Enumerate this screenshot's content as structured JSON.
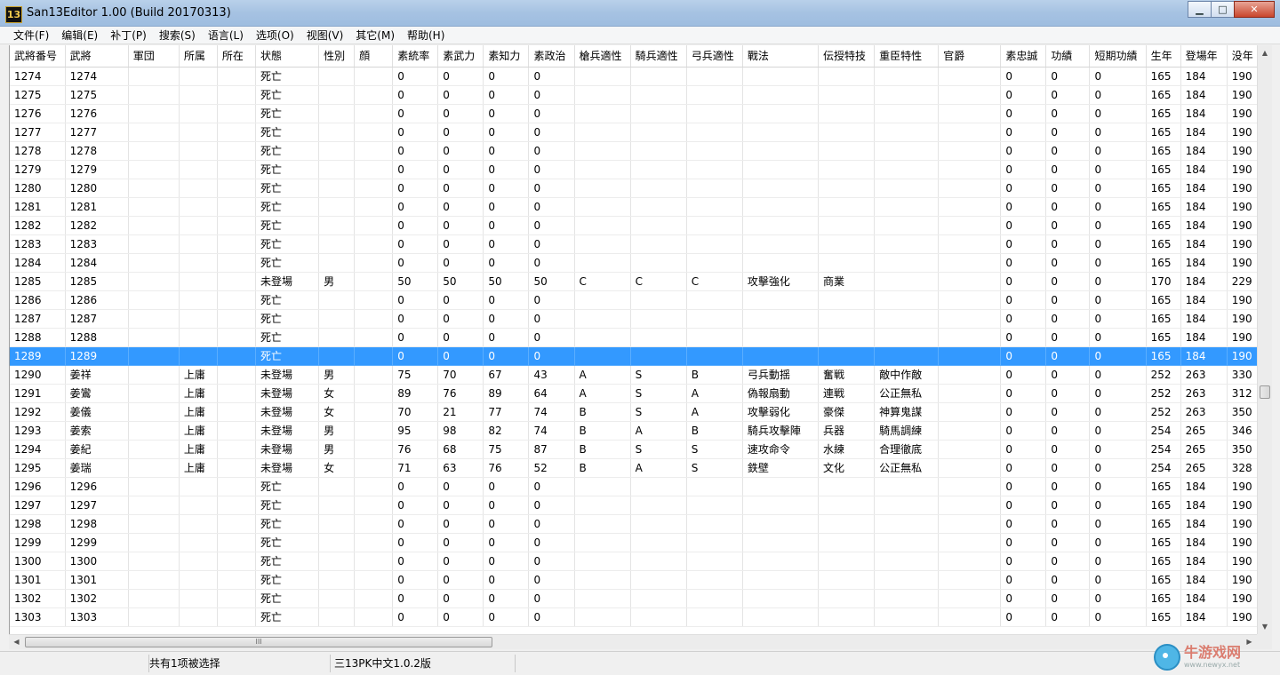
{
  "window": {
    "icon_text": "13",
    "title": "San13Editor 1.00 (Build 20170313)",
    "min_glyph": "▁",
    "max_glyph": "□",
    "close_glyph": "✕"
  },
  "menu": [
    {
      "label": "文件(F)"
    },
    {
      "label": "编辑(E)"
    },
    {
      "label": "补丁(P)"
    },
    {
      "label": "搜索(S)"
    },
    {
      "label": "语言(L)"
    },
    {
      "label": "选项(O)"
    },
    {
      "label": "视图(V)"
    },
    {
      "label": "其它(M)"
    },
    {
      "label": "帮助(H)"
    }
  ],
  "columns": [
    "武將番号",
    "武將",
    "軍団",
    "所属",
    "所在",
    "状態",
    "性別",
    "顔",
    "素統率",
    "素武力",
    "素知力",
    "素政治",
    "槍兵適性",
    "騎兵適性",
    "弓兵適性",
    "戰法",
    "伝授特技",
    "重臣特性",
    "官爵",
    "素忠誠",
    "功績",
    "短期功績",
    "生年",
    "登場年",
    "没年"
  ],
  "rows": [
    [
      "1274",
      "1274",
      "",
      "",
      "",
      "死亡",
      "",
      "",
      "0",
      "0",
      "0",
      "0",
      "",
      "",
      "",
      "",
      "",
      "",
      "",
      "0",
      "0",
      "0",
      "165",
      "184",
      "190"
    ],
    [
      "1275",
      "1275",
      "",
      "",
      "",
      "死亡",
      "",
      "",
      "0",
      "0",
      "0",
      "0",
      "",
      "",
      "",
      "",
      "",
      "",
      "",
      "0",
      "0",
      "0",
      "165",
      "184",
      "190"
    ],
    [
      "1276",
      "1276",
      "",
      "",
      "",
      "死亡",
      "",
      "",
      "0",
      "0",
      "0",
      "0",
      "",
      "",
      "",
      "",
      "",
      "",
      "",
      "0",
      "0",
      "0",
      "165",
      "184",
      "190"
    ],
    [
      "1277",
      "1277",
      "",
      "",
      "",
      "死亡",
      "",
      "",
      "0",
      "0",
      "0",
      "0",
      "",
      "",
      "",
      "",
      "",
      "",
      "",
      "0",
      "0",
      "0",
      "165",
      "184",
      "190"
    ],
    [
      "1278",
      "1278",
      "",
      "",
      "",
      "死亡",
      "",
      "",
      "0",
      "0",
      "0",
      "0",
      "",
      "",
      "",
      "",
      "",
      "",
      "",
      "0",
      "0",
      "0",
      "165",
      "184",
      "190"
    ],
    [
      "1279",
      "1279",
      "",
      "",
      "",
      "死亡",
      "",
      "",
      "0",
      "0",
      "0",
      "0",
      "",
      "",
      "",
      "",
      "",
      "",
      "",
      "0",
      "0",
      "0",
      "165",
      "184",
      "190"
    ],
    [
      "1280",
      "1280",
      "",
      "",
      "",
      "死亡",
      "",
      "",
      "0",
      "0",
      "0",
      "0",
      "",
      "",
      "",
      "",
      "",
      "",
      "",
      "0",
      "0",
      "0",
      "165",
      "184",
      "190"
    ],
    [
      "1281",
      "1281",
      "",
      "",
      "",
      "死亡",
      "",
      "",
      "0",
      "0",
      "0",
      "0",
      "",
      "",
      "",
      "",
      "",
      "",
      "",
      "0",
      "0",
      "0",
      "165",
      "184",
      "190"
    ],
    [
      "1282",
      "1282",
      "",
      "",
      "",
      "死亡",
      "",
      "",
      "0",
      "0",
      "0",
      "0",
      "",
      "",
      "",
      "",
      "",
      "",
      "",
      "0",
      "0",
      "0",
      "165",
      "184",
      "190"
    ],
    [
      "1283",
      "1283",
      "",
      "",
      "",
      "死亡",
      "",
      "",
      "0",
      "0",
      "0",
      "0",
      "",
      "",
      "",
      "",
      "",
      "",
      "",
      "0",
      "0",
      "0",
      "165",
      "184",
      "190"
    ],
    [
      "1284",
      "1284",
      "",
      "",
      "",
      "死亡",
      "",
      "",
      "0",
      "0",
      "0",
      "0",
      "",
      "",
      "",
      "",
      "",
      "",
      "",
      "0",
      "0",
      "0",
      "165",
      "184",
      "190"
    ],
    [
      "1285",
      "1285",
      "",
      "",
      "",
      "未登場",
      "男",
      "",
      "50",
      "50",
      "50",
      "50",
      "C",
      "C",
      "C",
      "攻擊強化",
      "商業",
      "",
      "",
      "0",
      "0",
      "0",
      "170",
      "184",
      "229"
    ],
    [
      "1286",
      "1286",
      "",
      "",
      "",
      "死亡",
      "",
      "",
      "0",
      "0",
      "0",
      "0",
      "",
      "",
      "",
      "",
      "",
      "",
      "",
      "0",
      "0",
      "0",
      "165",
      "184",
      "190"
    ],
    [
      "1287",
      "1287",
      "",
      "",
      "",
      "死亡",
      "",
      "",
      "0",
      "0",
      "0",
      "0",
      "",
      "",
      "",
      "",
      "",
      "",
      "",
      "0",
      "0",
      "0",
      "165",
      "184",
      "190"
    ],
    [
      "1288",
      "1288",
      "",
      "",
      "",
      "死亡",
      "",
      "",
      "0",
      "0",
      "0",
      "0",
      "",
      "",
      "",
      "",
      "",
      "",
      "",
      "0",
      "0",
      "0",
      "165",
      "184",
      "190"
    ],
    [
      "1289",
      "1289",
      "",
      "",
      "",
      "死亡",
      "",
      "",
      "0",
      "0",
      "0",
      "0",
      "",
      "",
      "",
      "",
      "",
      "",
      "",
      "0",
      "0",
      "0",
      "165",
      "184",
      "190"
    ],
    [
      "1290",
      "姜祥",
      "",
      "上庸",
      "",
      "未登場",
      "男",
      "",
      "75",
      "70",
      "67",
      "43",
      "A",
      "S",
      "B",
      "弓兵動揺",
      "奮戦",
      "敵中作敵",
      "",
      "0",
      "0",
      "0",
      "252",
      "263",
      "330"
    ],
    [
      "1291",
      "姜鸞",
      "",
      "上庸",
      "",
      "未登場",
      "女",
      "",
      "89",
      "76",
      "89",
      "64",
      "A",
      "S",
      "A",
      "偽報扇動",
      "連戦",
      "公正無私",
      "",
      "0",
      "0",
      "0",
      "252",
      "263",
      "312"
    ],
    [
      "1292",
      "姜儀",
      "",
      "上庸",
      "",
      "未登場",
      "女",
      "",
      "70",
      "21",
      "77",
      "74",
      "B",
      "S",
      "A",
      "攻擊弱化",
      "豪傑",
      "神算鬼謀",
      "",
      "0",
      "0",
      "0",
      "252",
      "263",
      "350"
    ],
    [
      "1293",
      "姜索",
      "",
      "上庸",
      "",
      "未登場",
      "男",
      "",
      "95",
      "98",
      "82",
      "74",
      "B",
      "A",
      "B",
      "騎兵攻擊陣",
      "兵器",
      "騎馬調練",
      "",
      "0",
      "0",
      "0",
      "254",
      "265",
      "346"
    ],
    [
      "1294",
      "姜紀",
      "",
      "上庸",
      "",
      "未登場",
      "男",
      "",
      "76",
      "68",
      "75",
      "87",
      "B",
      "S",
      "S",
      "速攻命令",
      "水練",
      "合理徹底",
      "",
      "0",
      "0",
      "0",
      "254",
      "265",
      "350"
    ],
    [
      "1295",
      "姜瑞",
      "",
      "上庸",
      "",
      "未登場",
      "女",
      "",
      "71",
      "63",
      "76",
      "52",
      "B",
      "A",
      "S",
      "鉄壁",
      "文化",
      "公正無私",
      "",
      "0",
      "0",
      "0",
      "254",
      "265",
      "328"
    ],
    [
      "1296",
      "1296",
      "",
      "",
      "",
      "死亡",
      "",
      "",
      "0",
      "0",
      "0",
      "0",
      "",
      "",
      "",
      "",
      "",
      "",
      "",
      "0",
      "0",
      "0",
      "165",
      "184",
      "190"
    ],
    [
      "1297",
      "1297",
      "",
      "",
      "",
      "死亡",
      "",
      "",
      "0",
      "0",
      "0",
      "0",
      "",
      "",
      "",
      "",
      "",
      "",
      "",
      "0",
      "0",
      "0",
      "165",
      "184",
      "190"
    ],
    [
      "1298",
      "1298",
      "",
      "",
      "",
      "死亡",
      "",
      "",
      "0",
      "0",
      "0",
      "0",
      "",
      "",
      "",
      "",
      "",
      "",
      "",
      "0",
      "0",
      "0",
      "165",
      "184",
      "190"
    ],
    [
      "1299",
      "1299",
      "",
      "",
      "",
      "死亡",
      "",
      "",
      "0",
      "0",
      "0",
      "0",
      "",
      "",
      "",
      "",
      "",
      "",
      "",
      "0",
      "0",
      "0",
      "165",
      "184",
      "190"
    ],
    [
      "1300",
      "1300",
      "",
      "",
      "",
      "死亡",
      "",
      "",
      "0",
      "0",
      "0",
      "0",
      "",
      "",
      "",
      "",
      "",
      "",
      "",
      "0",
      "0",
      "0",
      "165",
      "184",
      "190"
    ],
    [
      "1301",
      "1301",
      "",
      "",
      "",
      "死亡",
      "",
      "",
      "0",
      "0",
      "0",
      "0",
      "",
      "",
      "",
      "",
      "",
      "",
      "",
      "0",
      "0",
      "0",
      "165",
      "184",
      "190"
    ],
    [
      "1302",
      "1302",
      "",
      "",
      "",
      "死亡",
      "",
      "",
      "0",
      "0",
      "0",
      "0",
      "",
      "",
      "",
      "",
      "",
      "",
      "",
      "0",
      "0",
      "0",
      "165",
      "184",
      "190"
    ],
    [
      "1303",
      "1303",
      "",
      "",
      "",
      "死亡",
      "",
      "",
      "0",
      "0",
      "0",
      "0",
      "",
      "",
      "",
      "",
      "",
      "",
      "",
      "0",
      "0",
      "0",
      "165",
      "184",
      "190"
    ]
  ],
  "selected_row": "1289",
  "scroll": {
    "up_glyph": "▲",
    "down_glyph": "▼",
    "left_glyph": "◀",
    "right_glyph": "▶",
    "grip_glyph": "III"
  },
  "status": {
    "selection": "共有1项被选择",
    "version": "三13PK中文1.0.2版"
  },
  "watermark": {
    "text": "牛游戏网",
    "sub": "www.newyx.net"
  },
  "colors": {
    "selection": "#3399ff",
    "titlebar": "#b9d1ea"
  }
}
